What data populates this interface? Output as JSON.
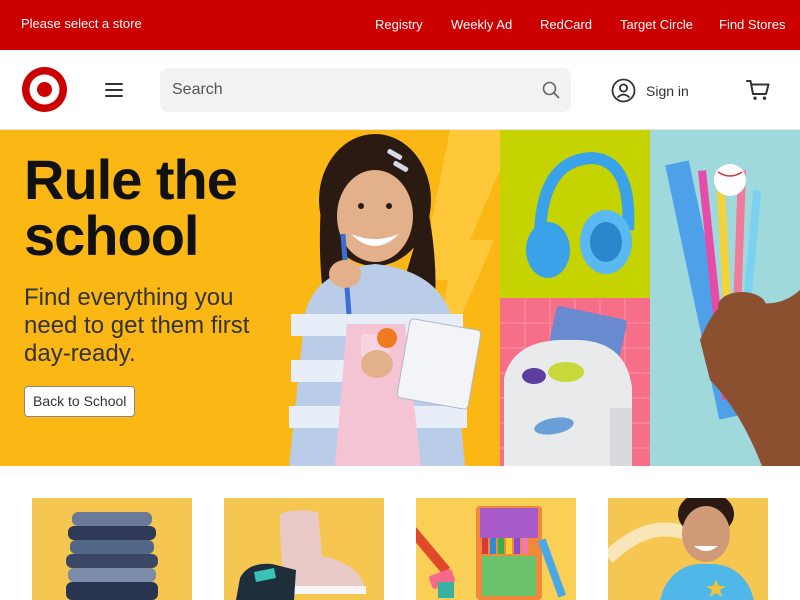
{
  "topbar": {
    "store_label": "Please select a store",
    "links": [
      "Registry",
      "Weekly Ad",
      "RedCard",
      "Target Circle",
      "Find Stores"
    ]
  },
  "header": {
    "logo_icon": "target-bullseye-logo",
    "menu_icon": "hamburger-menu-icon",
    "search": {
      "placeholder": "Search",
      "value": ""
    },
    "search_icon": "magnifier-icon",
    "signin_label": "Sign in",
    "signin_icon": "user-circle-icon",
    "cart_icon": "shopping-cart-icon"
  },
  "hero": {
    "title_line1": "Rule the",
    "title_line2": "school",
    "subtitle_line1": "Find everything you",
    "subtitle_line2": "need to get them first",
    "subtitle_line3": "day-ready.",
    "button_label": "Back to School"
  },
  "colors": {
    "brand_red": "#cc0000",
    "hero_yellow": "#fbb713",
    "tile_green": "#c5d400",
    "tile_pink": "#f76e89",
    "tile_blue": "#9fd9dc",
    "category_yellow": "#f6c750"
  },
  "categories": [
    {
      "image": "stacked-jeans"
    },
    {
      "image": "pink-sneakers"
    },
    {
      "image": "crayons-and-supplies"
    },
    {
      "image": "smiling-boy"
    }
  ]
}
